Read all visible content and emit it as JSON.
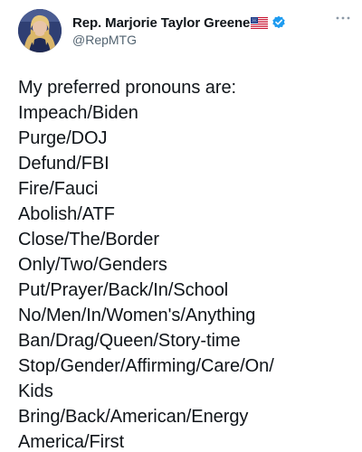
{
  "tweet": {
    "author": {
      "display_name": "Rep. Marjorie Taylor Greene",
      "handle": "@RepMTG",
      "flag_icon": "us-flag-icon",
      "verified_icon": "verified-badge-icon",
      "verified_color": "#1d9bf0"
    },
    "more_icon": "more-options-icon",
    "body_lines": [
      "My preferred pronouns are:",
      "Impeach/Biden",
      "Purge/DOJ",
      "Defund/FBI",
      "Fire/Fauci",
      "Abolish/ATF",
      "Close/The/Border",
      "Only/Two/Genders",
      "Put/Prayer/Back/In/School",
      "No/Men/In/Women's/Anything",
      "Ban/Drag/Queen/Story-time",
      "Stop/Gender/Affirming/Care/On/",
      "Kids",
      "Bring/Back/American/Energy",
      "America/First"
    ]
  }
}
